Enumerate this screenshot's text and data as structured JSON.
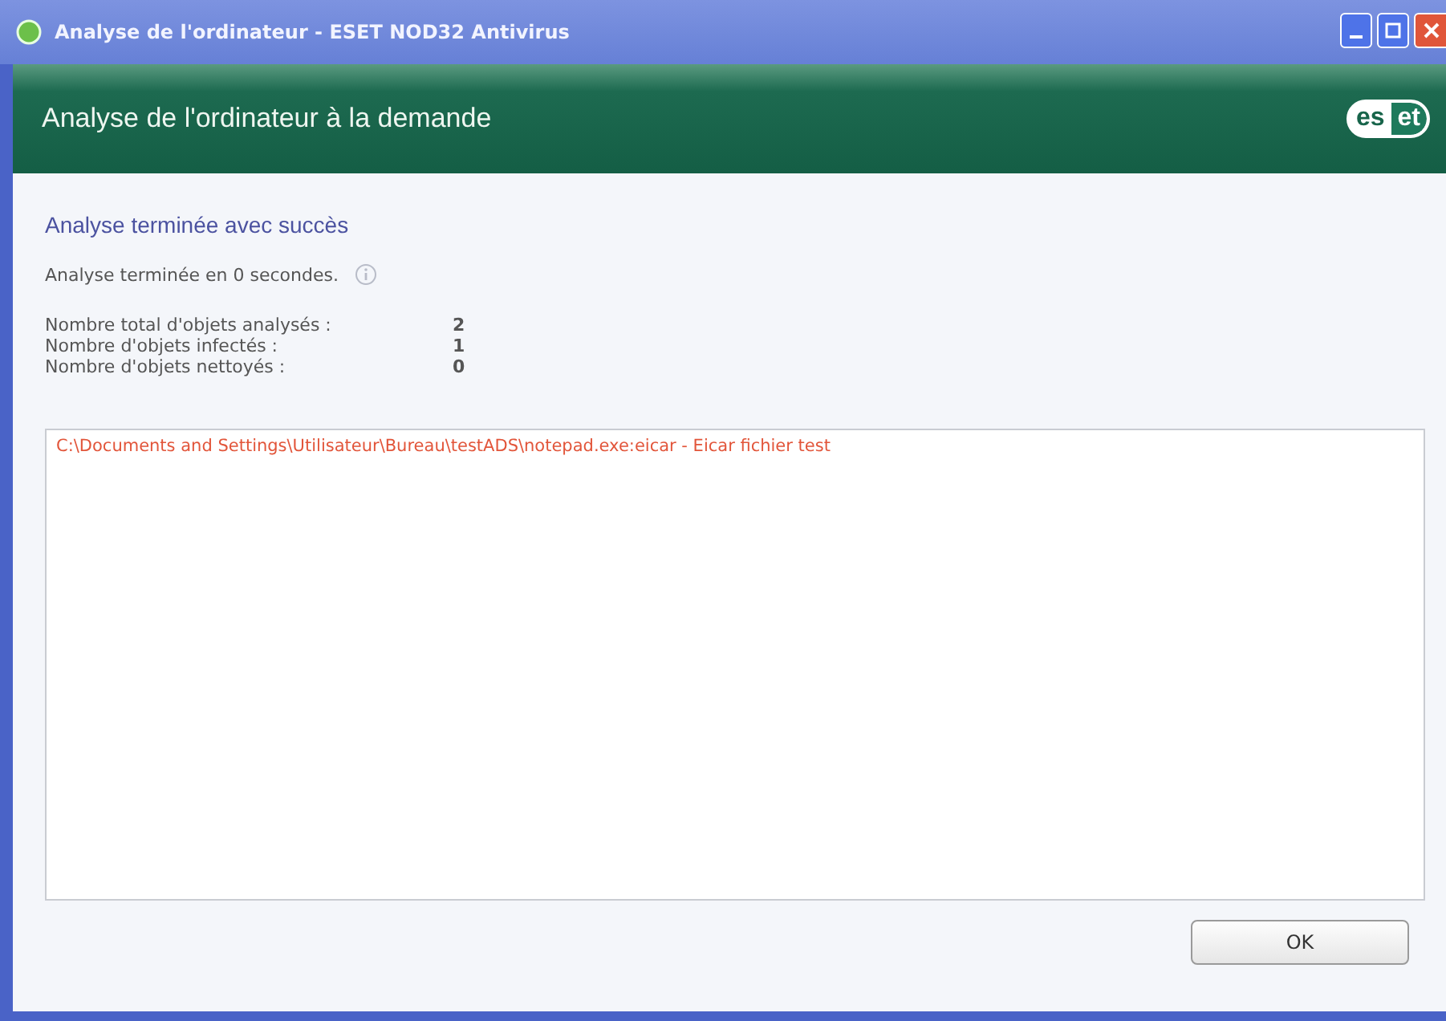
{
  "window": {
    "title": "Analyse de l'ordinateur - ESET NOD32 Antivirus"
  },
  "header": {
    "title": "Analyse de l'ordinateur à la demande",
    "logo": [
      "es",
      "et"
    ]
  },
  "result": {
    "heading": "Analyse terminée avec succès",
    "duration": "Analyse terminée en 0 secondes."
  },
  "stats": [
    {
      "label": "Nombre total d'objets analysés :",
      "value": "2"
    },
    {
      "label": "Nombre d'objets infectés :",
      "value": "1"
    },
    {
      "label": "Nombre d'objets nettoyés :",
      "value": "0"
    }
  ],
  "log": [
    "C:\\Documents and Settings\\Utilisateur\\Bureau\\testADS\\notepad.exe:eicar - Eicar fichier test"
  ],
  "buttons": [
    "OK"
  ]
}
